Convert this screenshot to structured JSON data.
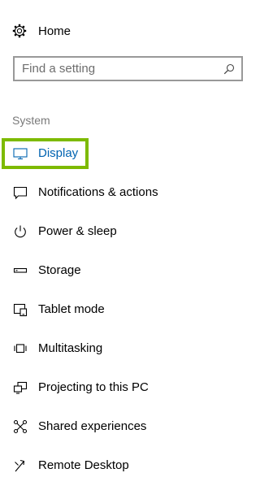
{
  "home": {
    "label": "Home",
    "icon": "gear-icon"
  },
  "search": {
    "placeholder": "Find a setting",
    "value": "",
    "icon": "search-icon"
  },
  "section_title": "System",
  "nav": {
    "items": [
      {
        "label": "Display",
        "icon": "monitor-icon",
        "selected": true
      },
      {
        "label": "Notifications & actions",
        "icon": "speech-bubble-icon"
      },
      {
        "label": "Power & sleep",
        "icon": "power-icon"
      },
      {
        "label": "Storage",
        "icon": "storage-drive-icon"
      },
      {
        "label": "Tablet mode",
        "icon": "tablet-mode-icon"
      },
      {
        "label": "Multitasking",
        "icon": "multitasking-icon"
      },
      {
        "label": "Projecting to this PC",
        "icon": "projecting-icon"
      },
      {
        "label": "Shared experiences",
        "icon": "shared-experiences-icon"
      },
      {
        "label": "Remote Desktop",
        "icon": "remote-desktop-icon"
      }
    ]
  },
  "colors": {
    "accent": "#0063b1",
    "highlight": "#7dba00",
    "section_text": "#7a7a7a",
    "search_border": "#999999"
  }
}
